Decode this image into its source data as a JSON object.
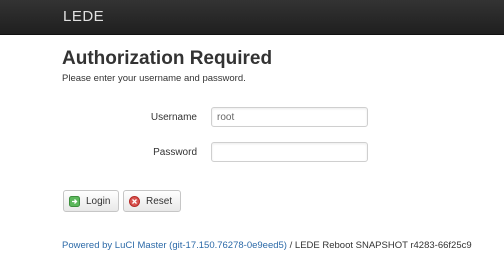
{
  "header": {
    "brand": "LEDE"
  },
  "main": {
    "title": "Authorization Required",
    "subtitle": "Please enter your username and password.",
    "username_label": "Username",
    "username_value": "root",
    "password_label": "Password",
    "password_value": ""
  },
  "actions": {
    "login_label": "Login",
    "reset_label": "Reset",
    "login_icon": "login-icon",
    "reset_icon": "reset-icon"
  },
  "footer": {
    "link_text": "Powered by LuCI Master (git-17.150.76278-0e9eed5)",
    "separator": " / ",
    "version_text": "LEDE Reboot SNAPSHOT r4283-66f25c9"
  },
  "colors": {
    "header_bg": "#222222",
    "link": "#2c6aa8",
    "login_icon": "#5cb85c",
    "reset_icon": "#d9534f"
  }
}
